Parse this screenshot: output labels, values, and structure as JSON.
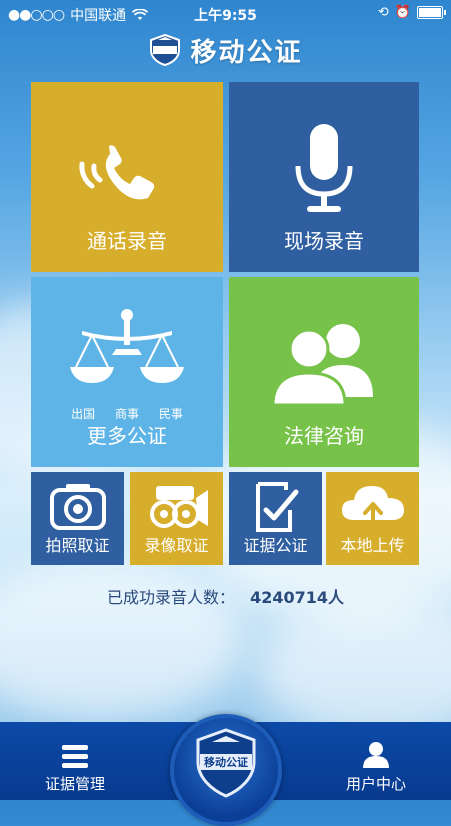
{
  "status_bar": {
    "carrier": "中国联通",
    "time": "上午9:55"
  },
  "header": {
    "title": "移动公证",
    "logo_text": "移动公证"
  },
  "tiles": [
    {
      "label": "通话录音",
      "icon": "phone-icon",
      "color": "#d7ad2c"
    },
    {
      "label": "现场录音",
      "icon": "microphone-icon",
      "color": "#2f5fa0"
    },
    {
      "label": "更多公证",
      "icon": "scales-icon",
      "color": "#5eb4e6",
      "subs": [
        "出国",
        "商事",
        "民事"
      ]
    },
    {
      "label": "法律咨询",
      "icon": "people-icon",
      "color": "#77c349"
    }
  ],
  "small_tiles": [
    {
      "label": "拍照取证",
      "icon": "camera-icon"
    },
    {
      "label": "录像取证",
      "icon": "video-camera-icon"
    },
    {
      "label": "证据公证",
      "icon": "checked-document-icon"
    },
    {
      "label": "本地上传",
      "icon": "cloud-upload-icon"
    }
  ],
  "counter": {
    "label": "已成功录音人数：",
    "value": "4240714人"
  },
  "bottom_bar": {
    "left_tab": "证据管理",
    "right_tab": "用户中心",
    "center_logo_text": "移动公证"
  }
}
